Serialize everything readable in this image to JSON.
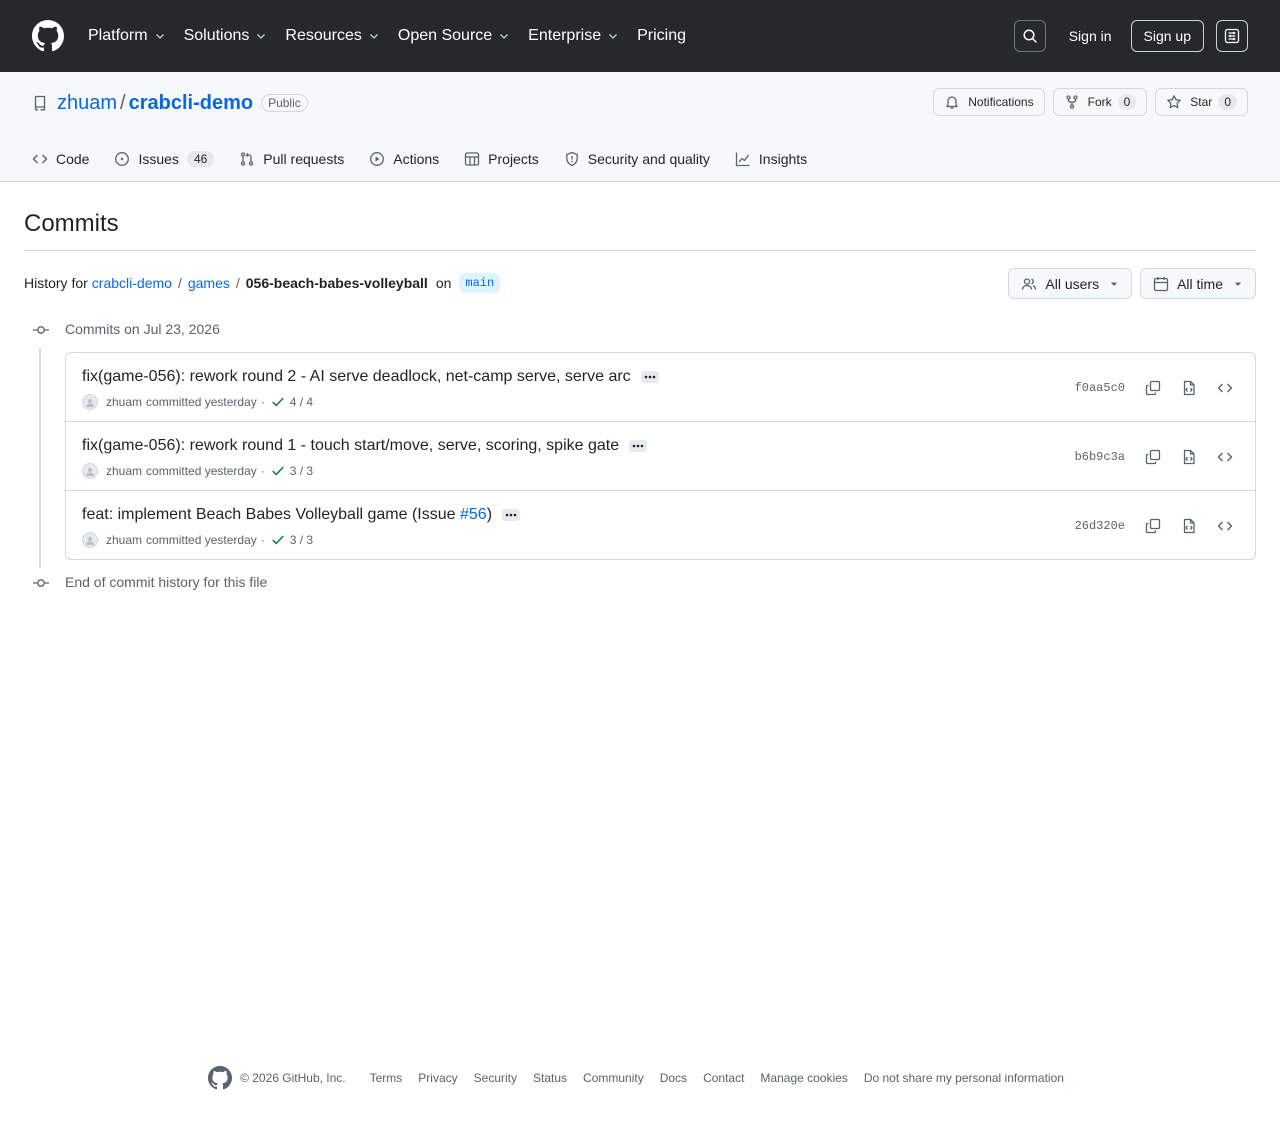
{
  "header": {
    "nav": [
      "Platform",
      "Solutions",
      "Resources",
      "Open Source",
      "Enterprise",
      "Pricing"
    ],
    "nav_has_chevron": [
      true,
      true,
      true,
      true,
      true,
      false
    ],
    "sign_in": "Sign in",
    "sign_up": "Sign up"
  },
  "repo": {
    "owner": "zhuam",
    "slash": "/",
    "name": "crabcli-demo",
    "visibility": "Public",
    "actions": {
      "notifications": "Notifications",
      "fork": "Fork",
      "fork_count": "0",
      "star": "Star",
      "star_count": "0"
    },
    "tabs": {
      "code": "Code",
      "issues": "Issues",
      "issues_count": "46",
      "pull_requests": "Pull requests",
      "actions": "Actions",
      "projects": "Projects",
      "security": "Security and quality",
      "insights": "Insights"
    }
  },
  "main": {
    "title": "Commits",
    "history": {
      "prefix": "History for",
      "repo_link": "crabcli-demo",
      "sep": "/",
      "folder": "games",
      "file": "056-beach-babes-volleyball",
      "on": "on",
      "branch": "main"
    },
    "filters": {
      "users": "All users",
      "time": "All time"
    },
    "group_label": "Commits on Jul 23, 2026",
    "end_label": "End of commit history for this file",
    "commits": [
      {
        "message": "fix(game-056): rework round 2 - AI serve deadlock, net-camp serve, serve arc",
        "issue_ref": "",
        "message_suffix": "",
        "author": "zhuam",
        "meta": "committed yesterday",
        "dot": "·",
        "checks": "4 / 4",
        "sha": "f0aa5c0"
      },
      {
        "message": "fix(game-056): rework round 1 - touch start/move, serve, scoring, spike gate",
        "issue_ref": "",
        "message_suffix": "",
        "author": "zhuam",
        "meta": "committed yesterday",
        "dot": "·",
        "checks": "3 / 3",
        "sha": "b6b9c3a"
      },
      {
        "message": "feat: implement Beach Babes Volleyball game (Issue ",
        "issue_ref": "#56",
        "message_suffix": ")",
        "author": "zhuam",
        "meta": "committed yesterday",
        "dot": "·",
        "checks": "3 / 3",
        "sha": "26d320e"
      }
    ]
  },
  "footer": {
    "copyright": "© 2026 GitHub, Inc.",
    "links": [
      "Terms",
      "Privacy",
      "Security",
      "Status",
      "Community",
      "Docs",
      "Contact",
      "Manage cookies",
      "Do not share my personal information"
    ]
  }
}
